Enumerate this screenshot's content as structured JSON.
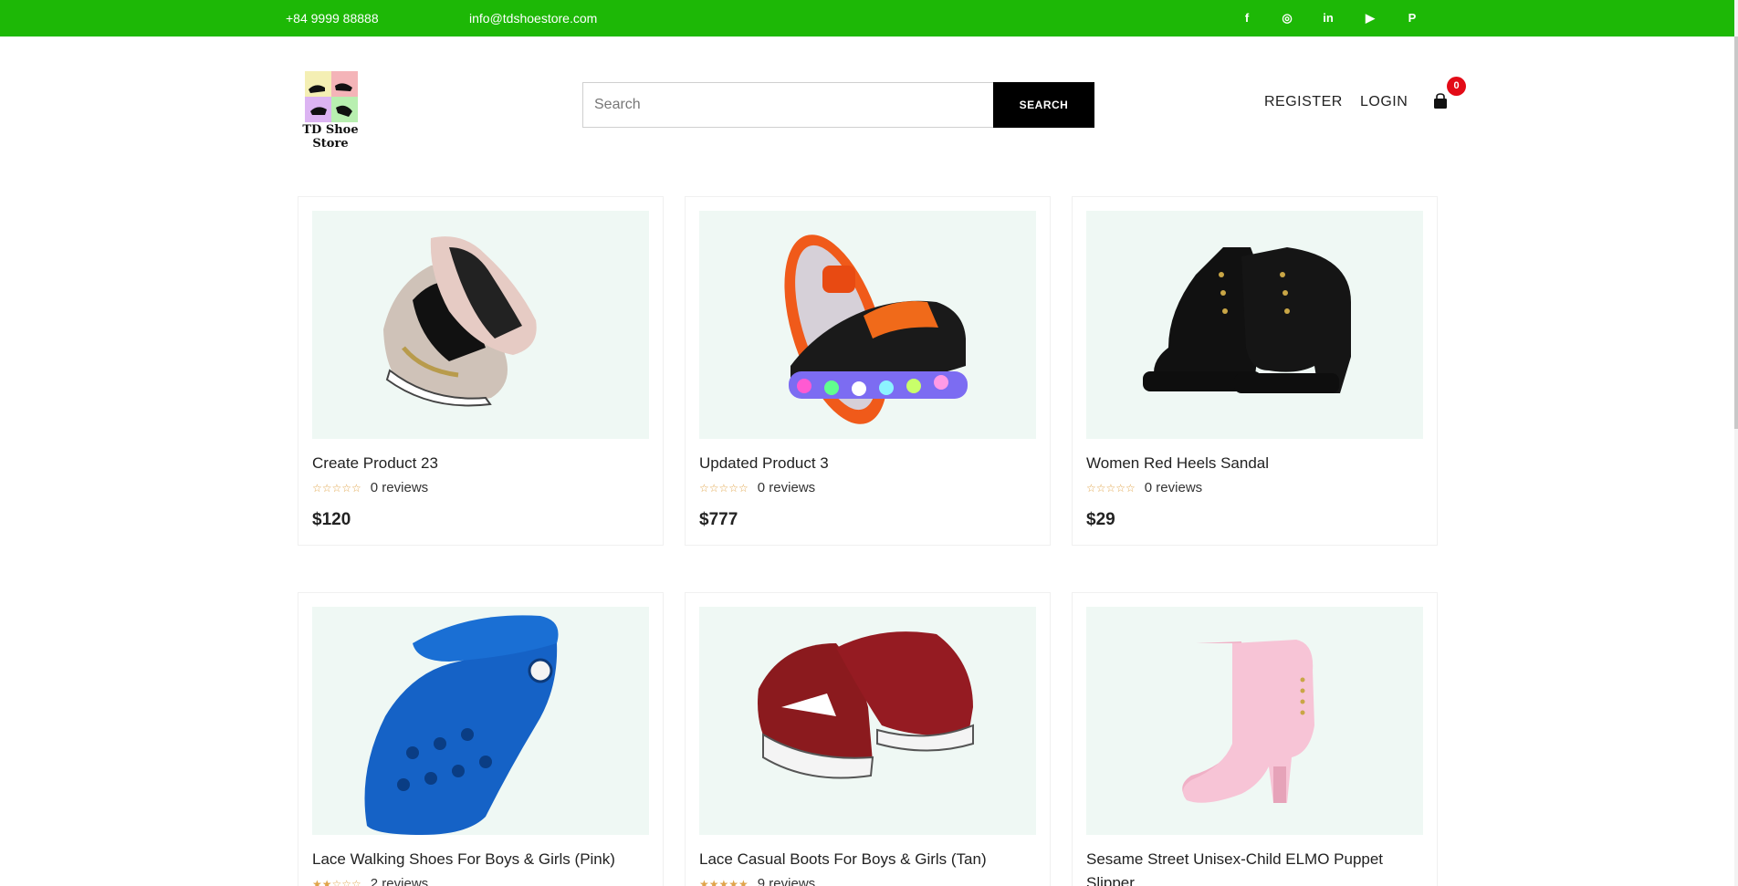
{
  "topbar": {
    "phone": "+84 9999 88888",
    "email": "info@tdshoestore.com",
    "social": [
      {
        "icon": "facebook-icon",
        "glyph": "f"
      },
      {
        "icon": "instagram-icon",
        "glyph": "◎"
      },
      {
        "icon": "linkedin-icon",
        "glyph": "in"
      },
      {
        "icon": "youtube-icon",
        "glyph": "▶"
      },
      {
        "icon": "pinterest-icon",
        "glyph": "P"
      }
    ],
    "color": "#1db806"
  },
  "header": {
    "logo_name": "TD Shoe Store",
    "search_placeholder": "Search",
    "search_button": "SEARCH",
    "register": "REGISTER",
    "login": "LOGIN",
    "cart_count": "0"
  },
  "products": [
    {
      "title": "Create Product 23",
      "stars": "☆☆☆☆☆",
      "reviews": "0 reviews",
      "price": "$120",
      "image": "sneaker-icon"
    },
    {
      "title": "Updated Product 3",
      "stars": "☆☆☆☆☆",
      "reviews": "0 reviews",
      "price": "$777",
      "image": "roller-shoe-icon"
    },
    {
      "title": "Women Red Heels Sandal",
      "stars": "☆☆☆☆☆",
      "reviews": "0 reviews",
      "price": "$29",
      "image": "black-boot-icon"
    },
    {
      "title": "Lace Walking Shoes For Boys & Girls (Pink)",
      "stars": "★★☆☆☆",
      "reviews": "2 reviews",
      "price": "",
      "image": "blue-clog-icon"
    },
    {
      "title": "Lace Casual Boots For Boys & Girls (Tan)",
      "stars": "★★★★★",
      "reviews": "9 reviews",
      "price": "",
      "image": "red-sneaker-icon"
    },
    {
      "title": "Sesame Street Unisex-Child ELMO Puppet Slipper",
      "stars": "",
      "reviews": "",
      "price": "",
      "image": "pink-boot-icon"
    }
  ]
}
